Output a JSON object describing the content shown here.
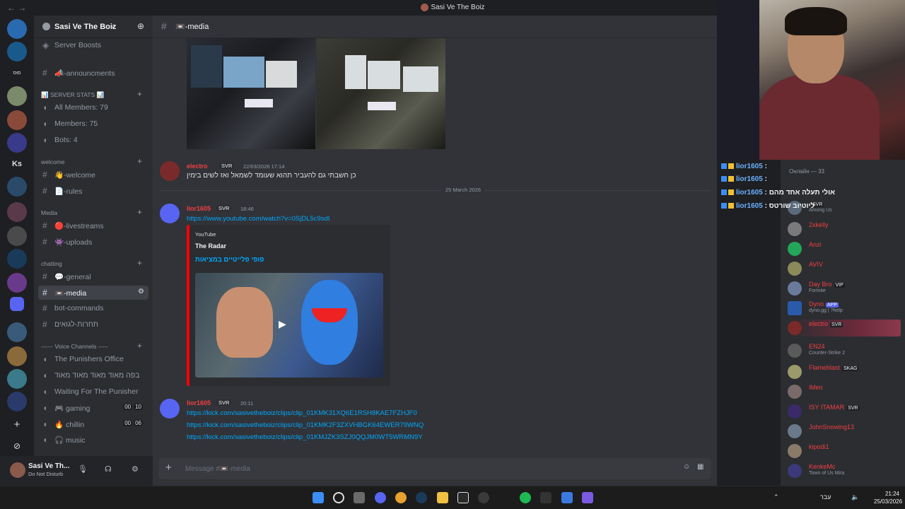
{
  "window": {
    "title": "Sasi Ve The Boiz",
    "nav": "← →"
  },
  "server": {
    "name": "Sasi Ve The Boiz",
    "boosts": "Server Boosts",
    "announcements": "📣-announcments",
    "stats_category": "📊 SERVER STATS 📊",
    "stats": [
      "All Members: 79",
      "Members: 75",
      "Bots: 4"
    ],
    "welcome_category": "welcome",
    "welcome_channels": [
      "👋-welcome",
      "📄-rules"
    ],
    "media_category": "Media",
    "media_channels": [
      "🔴-livestreams",
      "👾-uploads"
    ],
    "chatting_category": "chatting",
    "chatting_channels": [
      "💬-general",
      "📼-media",
      "bot-commands",
      "תחרות-לגואים"
    ],
    "voice_category": "------ Voice Channels -----",
    "voice_channels": [
      {
        "name": "The Punishers Office",
        "count": null
      },
      {
        "name": "בפה מאוד מאוד מאוד מאוד",
        "count": null
      },
      {
        "name": "Waiting For The Punisher",
        "count": null
      },
      {
        "name": "🎮 gaming",
        "count": [
          "00",
          "10"
        ]
      },
      {
        "name": "🔥 chillin",
        "count": [
          "00",
          "06"
        ]
      },
      {
        "name": "🎧 music",
        "count": null
      }
    ]
  },
  "user": {
    "name": "Sasi Ve Th...",
    "status": "Do Not Disturb"
  },
  "channel": {
    "name": "📼-media"
  },
  "messages": {
    "m1": {
      "author": "electro",
      "tag": "SVR",
      "time": "22/03/2026 17:14",
      "text": "כן חשבתי גם להעביר תהוא שעומד לשמאל ואז לשים בימין"
    },
    "divider": "25 March 2026",
    "m2": {
      "author": "lior1605",
      "tag": "SVR",
      "time": "18:46",
      "link": "https://www.youtube.com/watch?v=0SjDL5c9sdI",
      "embed": {
        "provider": "YouTube",
        "author": "The Radar",
        "title": "פופי פלייטיים במציאות"
      }
    },
    "m3": {
      "author": "lior1605",
      "tag": "SVR",
      "time": "20:11",
      "links": [
        "https://kick.com/sasivetheboiz/clips/clip_01KMK31XQ6E1RSH8KAE7FZHJF0",
        "https://kick.com/sasivetheboiz/clips/clip_01KMK2F3ZXVHBGK64EWER79WNQ",
        "https://kick.com/sasivetheboiz/clips/clip_01KMJZK3SZJ0QQJM0WT5WRMN9Y"
      ]
    }
  },
  "composer": {
    "placeholder": "Message #📼-media"
  },
  "chat_overlay": [
    {
      "name": "lior1605",
      "text": ""
    },
    {
      "name": "lior1605",
      "text": ""
    },
    {
      "name": "lior1605",
      "text": "אולי תעלה אחד מהם"
    },
    {
      "name": "lior1605",
      "text": "ליוטיוב שורטס"
    }
  ],
  "members": {
    "header": "Онлайн — 33",
    "list": [
      {
        "name": "",
        "status": "Among Us",
        "tag": "SVR"
      },
      {
        "name": "2xkelly",
        "status": "",
        "tag": ""
      },
      {
        "name": "Anzi",
        "status": "",
        "tag": ""
      },
      {
        "name": "AVIV",
        "status": "",
        "tag": ""
      },
      {
        "name": "Day Bro",
        "status": "Fortnite",
        "tag": "VIP"
      },
      {
        "name": "Dyno",
        "status": "dyno.gg | ?help",
        "tag": "APP"
      },
      {
        "name": "electro",
        "status": "",
        "tag": "SVR"
      },
      {
        "name": "EN24",
        "status": "Counter-Strike 2",
        "tag": ""
      },
      {
        "name": "Flameblast",
        "status": "",
        "tag": "SKAG"
      },
      {
        "name": "iMen",
        "status": "",
        "tag": ""
      },
      {
        "name": "ISY ITAMAR",
        "status": "",
        "tag": "SVR"
      },
      {
        "name": "JohnSnowing13",
        "status": "",
        "tag": ""
      },
      {
        "name": "kipodi1",
        "status": "",
        "tag": ""
      },
      {
        "name": "KenkeMc",
        "status": "Town of Us Mira",
        "tag": ""
      }
    ]
  },
  "taskbar": {
    "time": "21:24",
    "date": "25/03/2026",
    "lang": "עבר"
  },
  "colors": {
    "accent": "#5865f2",
    "link": "#00a8fc",
    "name_red": "#f23f42",
    "youtube": "#ff0000"
  }
}
